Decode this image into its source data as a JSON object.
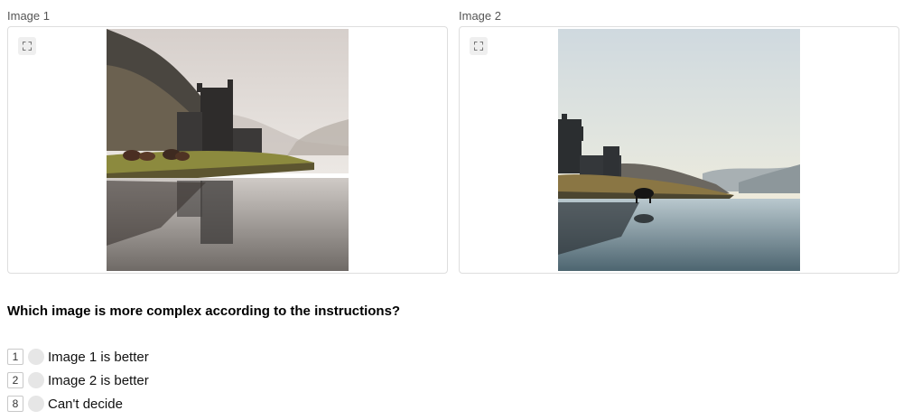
{
  "images": [
    {
      "label": "Image 1",
      "expand_icon": "expand-icon"
    },
    {
      "label": "Image 2",
      "expand_icon": "expand-icon"
    }
  ],
  "question": "Which image is more complex according to the instructions?",
  "options": [
    {
      "hotkey": "1",
      "label": "Image 1 is better"
    },
    {
      "hotkey": "2",
      "label": "Image 2 is better"
    },
    {
      "hotkey": "8",
      "label": "Can't decide"
    }
  ]
}
